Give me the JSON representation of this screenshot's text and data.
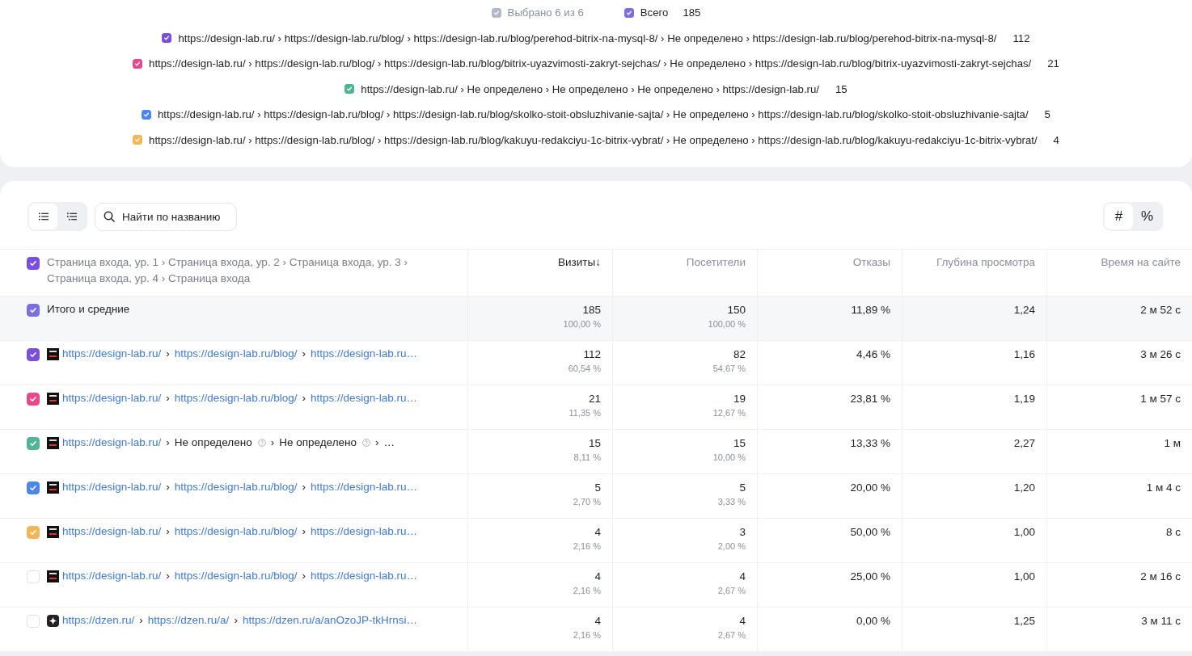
{
  "legend": {
    "selected": {
      "label": "Выбрано 6 из 6",
      "checked": true
    },
    "total": {
      "label": "Всего",
      "value": "185",
      "checked": true
    },
    "separator": "›",
    "items": [
      {
        "path": "https://design-lab.ru/ › https://design-lab.ru/blog/ › https://design-lab.ru/blog/perehod-bitrix-na-mysql-8/ › Не определено › https://design-lab.ru/blog/perehod-bitrix-na-mysql-8/",
        "count": "112",
        "color": "#7a4fe0",
        "checked": true
      },
      {
        "path": "https://design-lab.ru/ › https://design-lab.ru/blog/ › https://design-lab.ru/blog/bitrix-uyazvimosti-zakryt-sejchas/ › Не определено › https://design-lab.ru/blog/bitrix-uyazvimosti-zakryt-sejchas/",
        "count": "21",
        "color": "#e8478b",
        "checked": true
      },
      {
        "path": "https://design-lab.ru/ › Не определено › Не определено › Не определено › https://design-lab.ru/",
        "count": "15",
        "color": "#4fb595",
        "checked": true
      },
      {
        "path": "https://design-lab.ru/ › https://design-lab.ru/blog/ › https://design-lab.ru/blog/skolko-stoit-obsluzhivanie-sajta/ › Не определено › https://design-lab.ru/blog/skolko-stoit-obsluzhivanie-sajta/",
        "count": "5",
        "color": "#4d86ea",
        "checked": true
      },
      {
        "path": "https://design-lab.ru/ › https://design-lab.ru/blog/ › https://design-lab.ru/blog/kakuyu-redakciyu-1c-bitrix-vybrat/ › Не определено › https://design-lab.ru/blog/kakuyu-redakciyu-1c-bitrix-vybrat/",
        "count": "4",
        "color": "#f2b655",
        "checked": true
      }
    ]
  },
  "toolbar": {
    "views": [
      {
        "selected": true
      },
      {
        "selected": false
      }
    ],
    "search": {
      "placeholder": "Найти по названию"
    },
    "units": [
      {
        "label": "#",
        "selected": true
      },
      {
        "label": "%",
        "selected": false
      }
    ]
  },
  "table": {
    "header": {
      "label": "Страница входа, ур. 1 › Страница входа, ур. 2 › Страница входа, ур. 3 › Страница входа, ур. 4 › Страница входа",
      "checked": true
    },
    "columns": [
      {
        "label": "Визиты",
        "sort": "↓"
      },
      {
        "label": "Посетители"
      },
      {
        "label": "Отказы"
      },
      {
        "label": "Глубина просмотра"
      },
      {
        "label": "Время на сайте"
      }
    ],
    "total": {
      "label": "Итого и средние",
      "checked": true,
      "visits": "185",
      "visits_share": "100,00 %",
      "visitors": "150",
      "visitors_share": "100,00 %",
      "bounce": "11,89 %",
      "depth": "1,24",
      "time": "2 м 52 с"
    },
    "rows": [
      {
        "checked": true,
        "color": "#7a4fe0",
        "kind": "site",
        "segments": [
          {
            "text": "https://design-lab.ru/",
            "kind": "link"
          },
          {
            "text": "https://design-lab.ru/blog/",
            "kind": "link"
          },
          {
            "text": "https://design-lab.ru…",
            "kind": "link"
          }
        ],
        "visits": "112",
        "visits_share": "60,54 %",
        "visitors": "82",
        "visitors_share": "54,67 %",
        "bounce": "4,46 %",
        "depth": "1,16",
        "time": "3 м 26 с"
      },
      {
        "checked": true,
        "color": "#e8478b",
        "kind": "site",
        "segments": [
          {
            "text": "https://design-lab.ru/",
            "kind": "link"
          },
          {
            "text": "https://design-lab.ru/blog/",
            "kind": "link"
          },
          {
            "text": "https://design-lab.ru…",
            "kind": "link"
          }
        ],
        "visits": "21",
        "visits_share": "11,35 %",
        "visitors": "19",
        "visitors_share": "12,67 %",
        "bounce": "23,81 %",
        "depth": "1,19",
        "time": "1 м 57 с"
      },
      {
        "checked": true,
        "color": "#4fb595",
        "kind": "site",
        "segments": [
          {
            "text": "https://design-lab.ru/",
            "kind": "link"
          },
          {
            "text": "Не определено",
            "kind": "plain",
            "help": true
          },
          {
            "text": "Не определено",
            "kind": "plain",
            "help": true
          },
          {
            "text": "…",
            "kind": "plain"
          }
        ],
        "visits": "15",
        "visits_share": "8,11 %",
        "visitors": "15",
        "visitors_share": "10,00 %",
        "bounce": "13,33 %",
        "depth": "2,27",
        "time": "1 м"
      },
      {
        "checked": true,
        "color": "#4d86ea",
        "kind": "site",
        "segments": [
          {
            "text": "https://design-lab.ru/",
            "kind": "link"
          },
          {
            "text": "https://design-lab.ru/blog/",
            "kind": "link"
          },
          {
            "text": "https://design-lab.ru…",
            "kind": "link"
          }
        ],
        "visits": "5",
        "visits_share": "2,70 %",
        "visitors": "5",
        "visitors_share": "3,33 %",
        "bounce": "20,00 %",
        "depth": "1,20",
        "time": "1 м 4 с"
      },
      {
        "checked": true,
        "color": "#f2b655",
        "kind": "site",
        "segments": [
          {
            "text": "https://design-lab.ru/",
            "kind": "link"
          },
          {
            "text": "https://design-lab.ru/blog/",
            "kind": "link"
          },
          {
            "text": "https://design-lab.ru…",
            "kind": "link"
          }
        ],
        "visits": "4",
        "visits_share": "2,16 %",
        "visitors": "3",
        "visitors_share": "2,00 %",
        "bounce": "50,00 %",
        "depth": "1,00",
        "time": "8 с"
      },
      {
        "checked": false,
        "kind": "site",
        "segments": [
          {
            "text": "https://design-lab.ru/",
            "kind": "link"
          },
          {
            "text": "https://design-lab.ru/blog/",
            "kind": "link"
          },
          {
            "text": "https://design-lab.ru…",
            "kind": "link"
          }
        ],
        "visits": "4",
        "visits_share": "2,16 %",
        "visitors": "4",
        "visitors_share": "2,67 %",
        "bounce": "25,00 %",
        "depth": "1,00",
        "time": "2 м 16 с"
      },
      {
        "checked": false,
        "kind": "dzen",
        "segments": [
          {
            "text": "https://dzen.ru/",
            "kind": "link"
          },
          {
            "text": "https://dzen.ru/a/",
            "kind": "link"
          },
          {
            "text": "https://dzen.ru/a/anOzoJP-tkHrnsi…",
            "kind": "link"
          }
        ],
        "visits": "4",
        "visits_share": "2,16 %",
        "visitors": "4",
        "visitors_share": "2,67 %",
        "bounce": "0,00 %",
        "depth": "1,25",
        "time": "3 м 11 с"
      }
    ]
  }
}
